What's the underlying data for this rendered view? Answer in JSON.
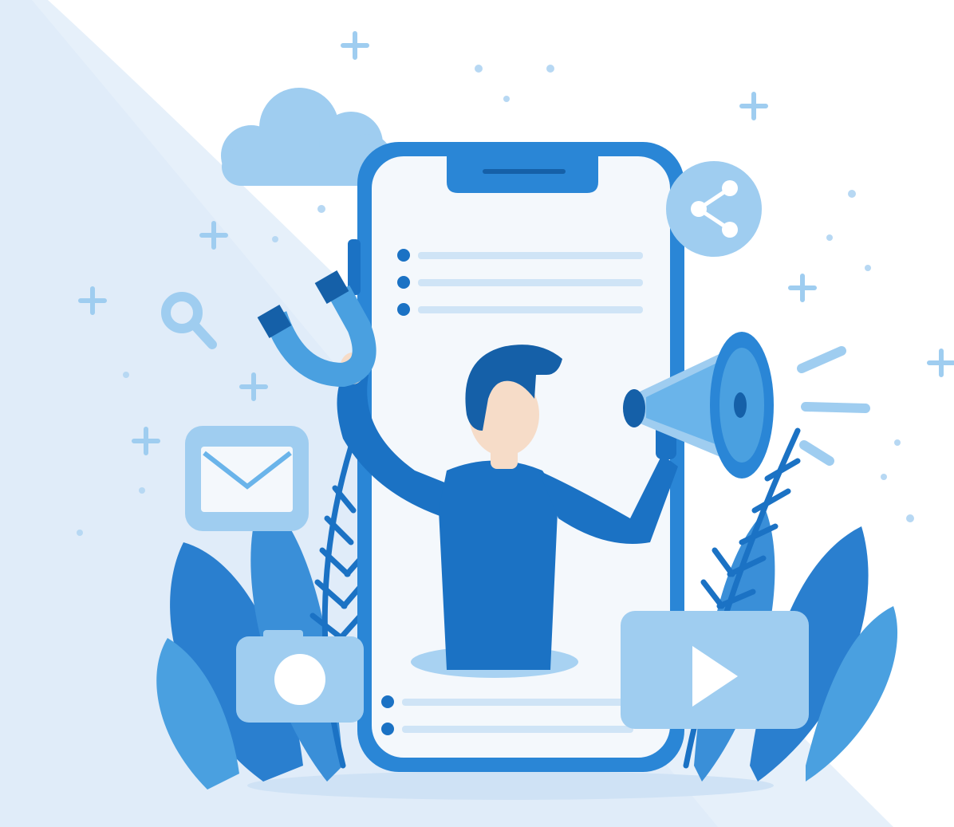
{
  "illustration": {
    "subject": "social-media-marketing",
    "elements": [
      "cloud-icon",
      "share-icon",
      "magnet-icon",
      "search-icon",
      "mail-icon",
      "camera-icon",
      "play-icon",
      "megaphone-icon",
      "person",
      "smartphone",
      "leaf-decorations",
      "sparkle-plus"
    ]
  },
  "colors": {
    "background_wedge": "#e3eef9",
    "light_blue": "#9fcdf0",
    "mid_blue": "#4aa0e0",
    "deep_blue": "#1b72c4",
    "navy": "#1560a8",
    "skin": "#f6dcc8",
    "phone_screen": "#f4f8fc"
  }
}
